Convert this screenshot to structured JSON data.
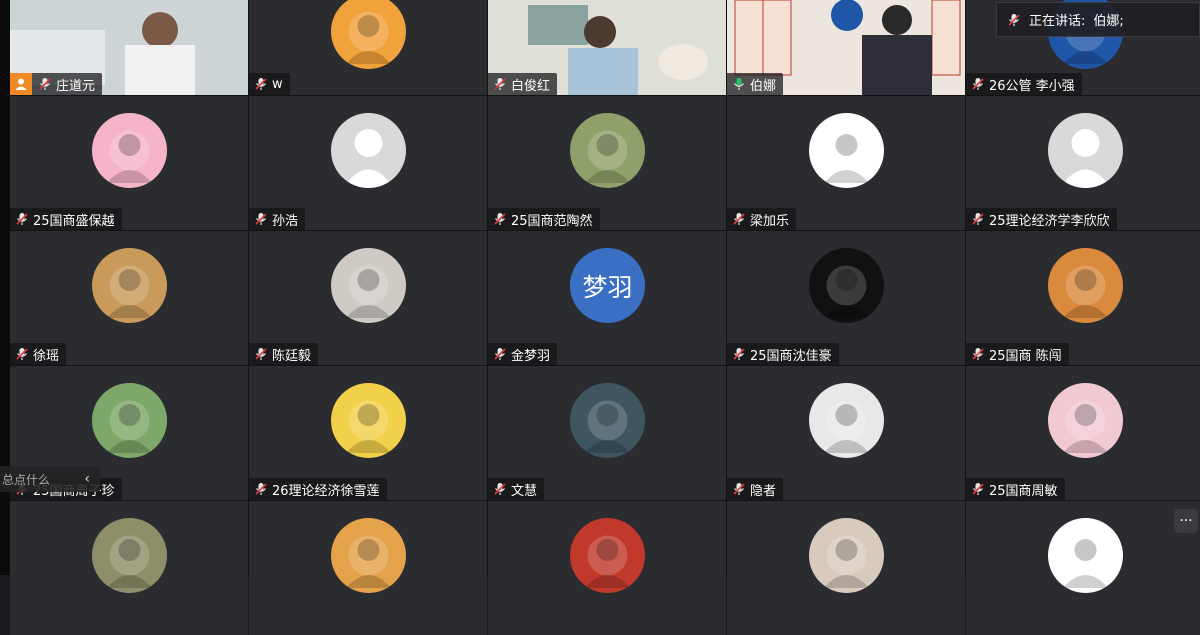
{
  "speaking_banner": {
    "label": "正在讲话:",
    "speaker": "伯娜;"
  },
  "floating_bar": {
    "text": "总点什么",
    "collapse_icon": "chevron-left-icon"
  },
  "more_button": {
    "label": "···",
    "icon": "more-horizontal-icon"
  },
  "colors": {
    "active_speaker_border": "#27c26b",
    "host_badge": "#f08a24",
    "mic_muted": "#e03b3b"
  },
  "participants": [
    {
      "name": "庄道元",
      "video": true,
      "host": true,
      "mic": "muted",
      "bg": "#cfd6d8"
    },
    {
      "name": "w",
      "video": false,
      "mic": "muted",
      "avatar_icon": "cartoon-tiger-avatar",
      "bg": "#f2a23b"
    },
    {
      "name": "白俊红",
      "video": true,
      "mic": "muted",
      "bg": "#d7d8d0"
    },
    {
      "name": "伯娜",
      "video": true,
      "mic": "on",
      "active": true,
      "bg": "#e9e2dc"
    },
    {
      "name": "26公管 李小强",
      "video": false,
      "mic": "muted",
      "avatar_icon": "blue-globe-avatar",
      "bg": "#1f56a8"
    },
    {
      "name": "25国商盛保越",
      "video": false,
      "mic": "muted",
      "avatar_icon": "pink-cat-avatar",
      "bg": "#f6b4c8"
    },
    {
      "name": "孙浩",
      "video": false,
      "mic": "muted",
      "avatar_icon": "default-person-avatar",
      "bg": "#d9d9d9"
    },
    {
      "name": "25国商范陶然",
      "video": false,
      "mic": "muted",
      "avatar_icon": "cartoon-bear-avatar",
      "bg": "#8fa06a"
    },
    {
      "name": "梁加乐",
      "video": false,
      "mic": "muted",
      "avatar_icon": "cola-bottle-avatar",
      "bg": "#ffffff"
    },
    {
      "name": "25理论经济学李欣欣",
      "video": false,
      "mic": "muted",
      "avatar_icon": "default-person-avatar",
      "bg": "#d9d9d9"
    },
    {
      "name": "徐瑶",
      "video": false,
      "mic": "muted",
      "avatar_icon": "golden-dog-avatar",
      "bg": "#c99a5a"
    },
    {
      "name": "陈廷毅",
      "video": false,
      "mic": "muted",
      "avatar_icon": "white-cat-sunglasses-avatar",
      "bg": "#cfcac4"
    },
    {
      "name": "金梦羽",
      "video": false,
      "mic": "muted",
      "avatar_text": "梦羽",
      "bg": "#3a6fc4"
    },
    {
      "name": "25国商沈佳豪",
      "video": false,
      "mic": "muted",
      "avatar_icon": "black-cat-avatar",
      "bg": "#111111"
    },
    {
      "name": "25国商 陈闯",
      "video": false,
      "mic": "muted",
      "avatar_icon": "sunset-person-avatar",
      "bg": "#d98a3d"
    },
    {
      "name": "25国商周子珍",
      "video": false,
      "mic": "muted",
      "avatar_icon": "girl-garden-avatar",
      "bg": "#7ea86a"
    },
    {
      "name": "26理论经济徐雪莲",
      "video": false,
      "mic": "muted",
      "avatar_icon": "yellow-hat-avatar",
      "bg": "#f2d04a"
    },
    {
      "name": "文慧",
      "video": false,
      "mic": "muted",
      "avatar_icon": "girl-portrait-avatar",
      "bg": "#3f5560"
    },
    {
      "name": "隐者",
      "video": false,
      "mic": "muted",
      "avatar_icon": "sunglasses-boy-avatar",
      "bg": "#e8e8e8"
    },
    {
      "name": "25国商周敏",
      "video": false,
      "mic": "muted",
      "avatar_icon": "anime-girl-avatar",
      "bg": "#f1c9d3"
    },
    {
      "name": "",
      "video": false,
      "mic": "muted",
      "avatar_icon": "girl-hat-avatar",
      "bg": "#8e8e6a"
    },
    {
      "name": "",
      "video": false,
      "mic": "muted",
      "avatar_icon": "orange-cat-avatar",
      "bg": "#e4a24a"
    },
    {
      "name": "",
      "video": false,
      "mic": "muted",
      "avatar_icon": "red-girl-avatar",
      "bg": "#c0392b"
    },
    {
      "name": "",
      "video": false,
      "mic": "muted",
      "avatar_icon": "girl-flowers-avatar",
      "bg": "#d8cbbd"
    },
    {
      "name": "",
      "video": false,
      "mic": "muted",
      "avatar_icon": "cinnamoroll-avatar",
      "bg": "#ffffff"
    }
  ]
}
